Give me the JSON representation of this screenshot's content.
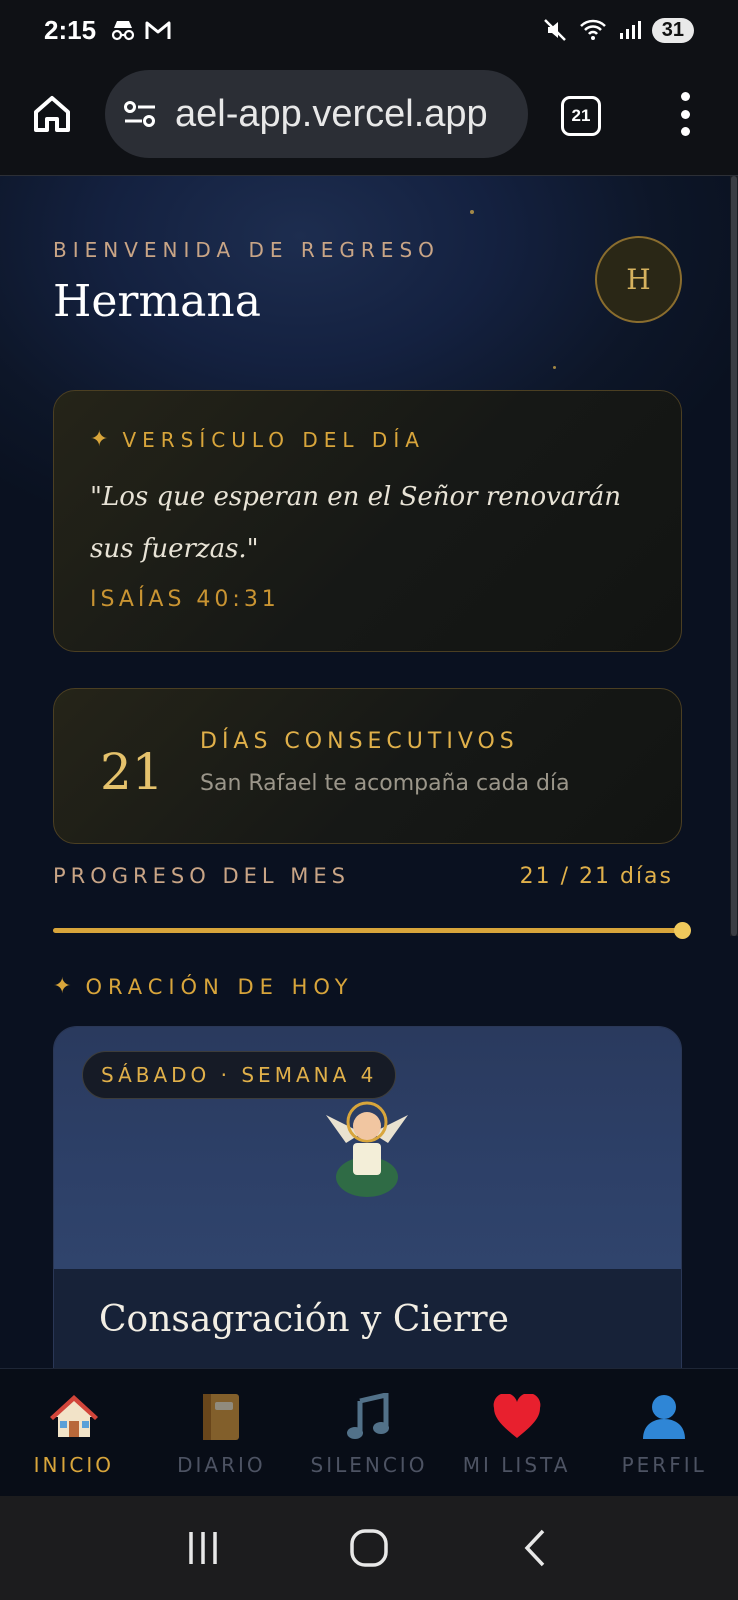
{
  "status": {
    "time": "2:15",
    "battery": "31"
  },
  "browser": {
    "url": "ael-app.vercel.app",
    "tab_count": "21"
  },
  "header": {
    "welcome": "BIENVENIDA DE REGRESO",
    "name": "Hermana",
    "avatar_initial": "H"
  },
  "verse": {
    "label": "VERSÍCULO DEL DÍA",
    "text": "\"Los que esperan en el Señor renovarán sus fuerzas.\"",
    "reference": "ISAÍAS 40:31"
  },
  "streak": {
    "number": "21",
    "title": "DÍAS CONSECUTIVOS",
    "subtitle": "San Rafael te acompaña cada día"
  },
  "progress": {
    "label": "PROGRESO DEL MES",
    "count_text": "21 / 21 días",
    "fraction": 1.0
  },
  "today": {
    "section_label": "ORACIÓN DE HOY",
    "badge": "SÁBADO · SEMANA 4",
    "title": "Consagración y Cierre"
  },
  "nav": {
    "items": [
      {
        "label": "INICIO",
        "icon": "house-icon",
        "active": true
      },
      {
        "label": "DIARIO",
        "icon": "notebook-icon",
        "active": false
      },
      {
        "label": "SILENCIO",
        "icon": "music-note-icon",
        "active": false
      },
      {
        "label": "MI LISTA",
        "icon": "heart-icon",
        "active": false
      },
      {
        "label": "PERFIL",
        "icon": "person-icon",
        "active": false
      }
    ]
  },
  "colors": {
    "accent_gold": "#d8a53b",
    "background_navy": "#0d1628"
  }
}
